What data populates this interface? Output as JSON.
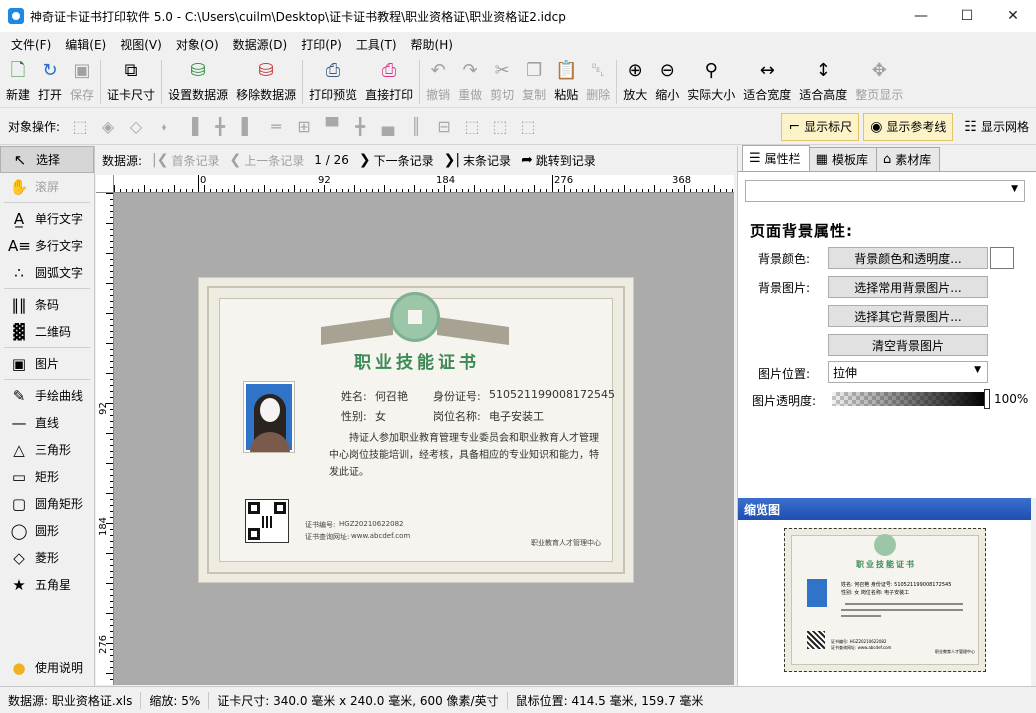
{
  "window": {
    "title": "神奇证卡证书打印软件 5.0 - C:\\Users\\cuilm\\Desktop\\证卡证书教程\\职业资格证\\职业资格证2.idcp",
    "minimize_icon": "minimize-icon",
    "maximize_icon": "maximize-icon",
    "close_icon": "close-icon"
  },
  "menu": [
    "文件(F)",
    "编辑(E)",
    "视图(V)",
    "对象(O)",
    "数据源(D)",
    "打印(P)",
    "工具(T)",
    "帮助(H)"
  ],
  "toolbar": {
    "new": "新建",
    "open": "打开",
    "save": "保存",
    "card_size": "证卡尺寸",
    "set_datasource": "设置数据源",
    "remove_datasource": "移除数据源",
    "print_preview": "打印预览",
    "direct_print": "直接打印",
    "undo": "撤销",
    "redo": "重做",
    "cut": "剪切",
    "copy": "复制",
    "paste": "粘贴",
    "delete": "删除",
    "zoom_in": "放大",
    "zoom_out": "缩小",
    "actual_size": "实际大小",
    "fit_width": "适合宽度",
    "fit_height": "适合高度",
    "fit_page": "整页显示"
  },
  "objbar": {
    "label": "对象操作:",
    "show_ruler": "显示标尺",
    "show_guides": "显示参考线",
    "show_grid": "显示网格"
  },
  "tools": {
    "select": "选择",
    "scroll": "滚屏",
    "single_text": "单行文字",
    "multi_text": "多行文字",
    "arc_text": "圆弧文字",
    "barcode": "条码",
    "qrcode": "二维码",
    "image": "图片",
    "freehand": "手绘曲线",
    "line": "直线",
    "triangle": "三角形",
    "rectangle": "矩形",
    "round_rect": "圆角矩形",
    "ellipse": "圆形",
    "diamond": "菱形",
    "star": "五角星",
    "help": "使用说明"
  },
  "navbar": {
    "label": "数据源:",
    "first": "首条记录",
    "prev": "上一条记录",
    "position": "1 / 26",
    "next": "下一条记录",
    "last": "末条记录",
    "goto": "跳转到记录"
  },
  "ruler": {
    "h": [
      "0",
      "92",
      "184",
      "276",
      "368"
    ],
    "v": [
      "92",
      "184",
      "276"
    ]
  },
  "certificate": {
    "title": "职业技能证书",
    "name_label": "姓名:",
    "name": "何召艳",
    "id_label": "身份证号:",
    "id_number": "510521199008172545",
    "gender_label": "性别:",
    "gender": "女",
    "position_label": "岗位名称:",
    "position": "电子安装工",
    "description": "持证人参加职业教育管理专业委员会和职业教育人才管理中心岗位技能培训，经考核，具备相应的专业知识和能力，特发此证。",
    "cert_no_label": "证书编号:",
    "cert_no": "HGZ20210622082",
    "query_label": "证书查询网址:",
    "query_url": "www.abcdef.com",
    "issuer": "职业教育人才管理中心"
  },
  "rightpanel": {
    "tabs": [
      "属性栏",
      "模板库",
      "素材库"
    ],
    "heading": "页面背景属性:",
    "bg_color_label": "背景颜色:",
    "bg_color_btn": "背景颜色和透明度...",
    "bg_image_label": "背景图片:",
    "choose_common_bg": "选择常用背景图片...",
    "choose_other_bg": "选择其它背景图片...",
    "clear_bg": "清空背景图片",
    "image_pos_label": "图片位置:",
    "image_pos_value": "拉伸",
    "image_alpha_label": "图片透明度:",
    "image_alpha_value": "100%",
    "preview_title": "缩览图"
  },
  "preview": {
    "title": "职业技能证书",
    "name_line": "姓名:  何召艳      身份证号: 510521199008172545",
    "gender_line": "性别:  女          岗位名称: 电子安装工",
    "cert_no_line": "证书编号: HGZ20210622082",
    "query_line": "证书查询网址: www.abcdef.com",
    "issuer": "职业教育人才管理中心"
  },
  "status": {
    "datasource": "数据源: 职业资格证.xls",
    "zoom": "缩放: 5%",
    "card_size": "证卡尺寸: 340.0 毫米 x 240.0 毫米, 600 像素/英寸",
    "mouse_pos": "鼠标位置: 414.5 毫米, 159.7 毫米"
  }
}
